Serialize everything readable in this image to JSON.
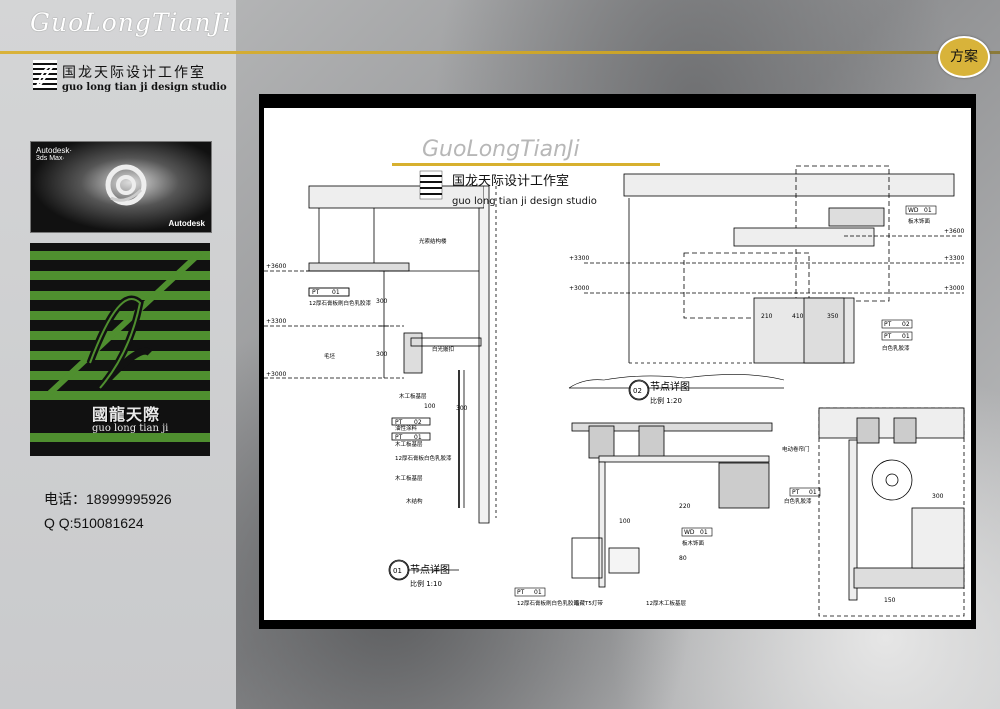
{
  "brand": {
    "script_name": "GuoLongTianJi",
    "studio_cn": "国龙天际设计工作室",
    "studio_en": "guo long tian ji design studio"
  },
  "badge": "方案",
  "max_logo": {
    "line1": "Autodesk·",
    "line2": "3ds Max·",
    "vendor": "Autodesk",
    "icon": "3dsmax-logo"
  },
  "green_logo": {
    "cn": "國龍天際",
    "en": "guo long tian ji"
  },
  "contact": {
    "phone": "电话：18999995926",
    "qq": "Q   Q:510081624"
  },
  "drawing": {
    "watermark_brand": "GuoLongTianJi",
    "watermark_cn": "国龙天际设计工作室",
    "watermark_en": "guo long tian ji design studio",
    "detail1": {
      "num": "01",
      "title": "节点详图",
      "scale": "比例  1:10"
    },
    "detail2": {
      "num": "02",
      "title": "节点详图",
      "scale": "比例  1:20"
    },
    "levels": [
      "+3600",
      "+3300",
      "+3000"
    ],
    "dims": [
      "300",
      "300",
      "100",
      "300",
      "210",
      "410",
      "350",
      "100",
      "220",
      "80",
      "150",
      "300"
    ],
    "tags": {
      "pt": "PT",
      "pt01": "01",
      "pt02": "02",
      "wd": "WD",
      "wd01": "01"
    },
    "notes1": [
      "光索结构楼",
      "12厚石膏板刷白色乳胶漆",
      "毛坯",
      "白光嵌扣",
      "木工板基层",
      "油性涂料",
      "木工板基层",
      "12厚石膏板白色乳胶漆",
      "木工板基层",
      "木结构"
    ],
    "notes2": [
      "板木饰面",
      "白色乳胶漆"
    ],
    "notes3": [
      "12厚石膏板刷白色乳胶漆",
      "暗藏T5灯带",
      "12厚木工板基层",
      "板木饰面"
    ],
    "notes4": [
      "电动卷帘门",
      "白色乳胶漆"
    ]
  }
}
